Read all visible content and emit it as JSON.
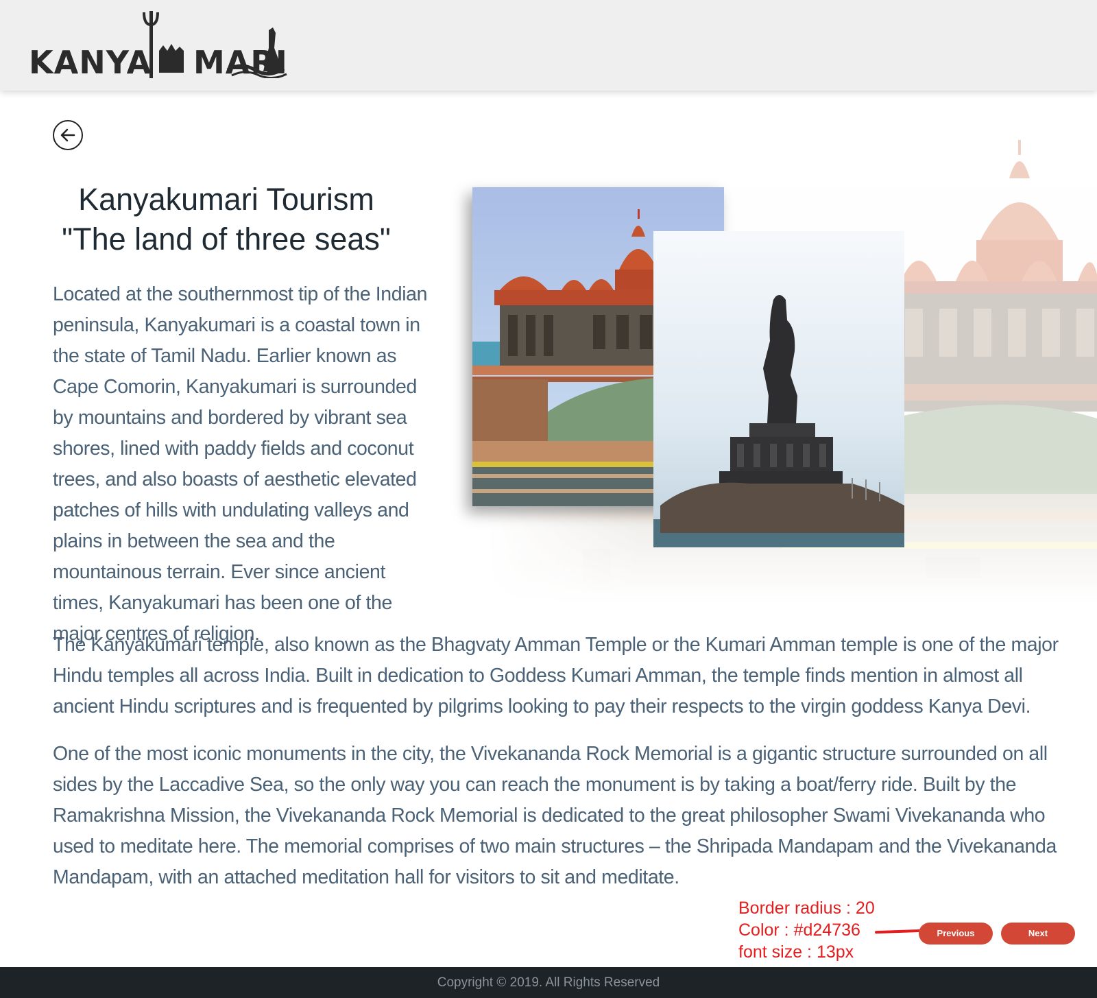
{
  "header": {
    "logo_text_left": "KANYA",
    "logo_text_right": "MARI",
    "logo_alt": "KANYAKUMARI"
  },
  "icons": {
    "back": "arrow-left-circle-icon"
  },
  "title": {
    "line1": "Kanyakumari Tourism",
    "line2": "\"The land of three seas\""
  },
  "content": {
    "p1": "Located at the southernmost tip of the Indian peninsula, Kanyakumari is a coastal town in the state of Tamil Nadu. Earlier known as Cape Comorin, Kanyakumari is surrounded by mountains and bordered by vibrant sea shores, lined with paddy fields and coconut trees, and also boasts of aesthetic elevated patches of hills with undulating valleys and plains in between the sea and the mountainous terrain. Ever since ancient times, Kanyakumari has been one of the major centres of religion.",
    "p2": "The Kanyakumari temple, also known as the Bhagvaty Amman Temple or the Kumari Amman temple is one of the major Hindu temples all across India. Built in dedication to Goddess Kumari Amman, the temple finds mention in almost all ancient Hindu scriptures and is frequented by pilgrims looking to pay their respects to the virgin goddess Kanya Devi.",
    "p3": "One of the most iconic monuments in the city, the Vivekananda Rock Memorial is a gigantic structure surrounded on all sides by the Laccadive Sea, so the only way you can reach the monument is by taking a boat/ferry ride. Built by the Ramakrishna Mission, the Vivekananda Rock Memorial is dedicated to the great philosopher Swami Vivekananda who used to meditate here. The memorial comprises of two main structures – the Shripada Mandapam and the Vivekananda Mandapam, with an attached meditation hall for visitors to sit and meditate."
  },
  "annotation": {
    "line1": "Border radius : 20",
    "line2": "Color : #d24736",
    "line3": "font size : 13px"
  },
  "nav": {
    "previous_label": "Previous",
    "next_label": "Next"
  },
  "footer": {
    "copyright": "Copyright © 2019. All Rights Reserved"
  },
  "colors": {
    "accent": "#d24736",
    "header_bg": "#efefef",
    "footer_bg": "#1e2328",
    "body_text": "#4a6176",
    "title_text": "#1f2a33",
    "annotation": "#e41e1e"
  }
}
